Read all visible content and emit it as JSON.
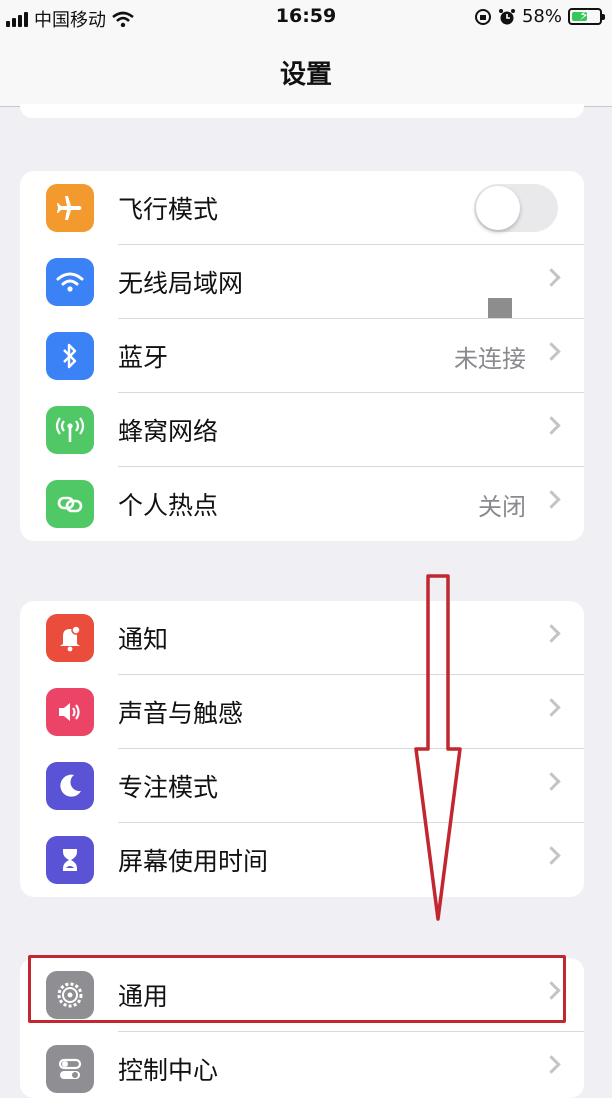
{
  "status_bar": {
    "carrier": "中国移动",
    "time": "16:59",
    "battery_percent": "58%",
    "battery_level": 0.58,
    "icons": [
      "signal-icon",
      "wifi-icon",
      "orientation-lock-icon",
      "alarm-icon",
      "battery-charging-icon"
    ]
  },
  "nav": {
    "title": "设置"
  },
  "groups": [
    {
      "rows": [
        {
          "label": "飞行模式",
          "icon": "airplane-icon",
          "icon_color": "#f29a2e",
          "toggle": false
        },
        {
          "label": "无线局域网",
          "icon": "wifi-icon",
          "icon_color": "#3b82f6",
          "value": ""
        },
        {
          "label": "蓝牙",
          "icon": "bluetooth-icon",
          "icon_color": "#3b82f6",
          "value": "未连接"
        },
        {
          "label": "蜂窝网络",
          "icon": "cellular-icon",
          "icon_color": "#4fc865",
          "value": ""
        },
        {
          "label": "个人热点",
          "icon": "hotspot-icon",
          "icon_color": "#4fc865",
          "value": "关闭"
        }
      ]
    },
    {
      "rows": [
        {
          "label": "通知",
          "icon": "notification-bell-icon",
          "icon_color": "#eb4d3d"
        },
        {
          "label": "声音与触感",
          "icon": "speaker-icon",
          "icon_color": "#eb4466"
        },
        {
          "label": "专注模式",
          "icon": "moon-icon",
          "icon_color": "#5a53d6"
        },
        {
          "label": "屏幕使用时间",
          "icon": "hourglass-icon",
          "icon_color": "#5a53d6"
        }
      ]
    },
    {
      "rows": [
        {
          "label": "通用",
          "icon": "gear-icon",
          "icon_color": "#8e8e93"
        },
        {
          "label": "控制中心",
          "icon": "control-center-icon",
          "icon_color": "#8e8e93"
        }
      ]
    }
  ],
  "annotation": {
    "arrow_color": "#c2262e",
    "box_color": "#c2262e"
  }
}
